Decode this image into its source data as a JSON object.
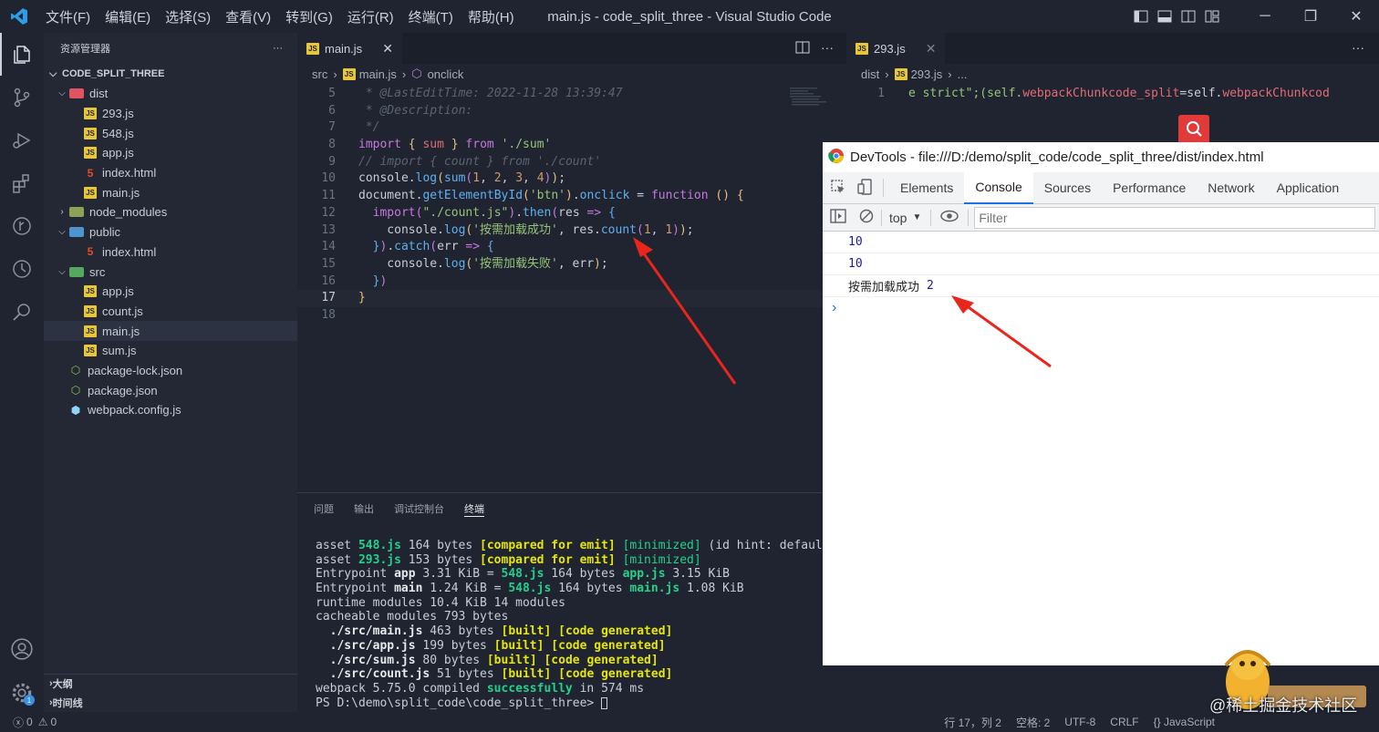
{
  "titlebar": {
    "menus": [
      "文件(F)",
      "编辑(E)",
      "选择(S)",
      "查看(V)",
      "转到(G)",
      "运行(R)",
      "终端(T)",
      "帮助(H)"
    ],
    "title": "main.js - code_split_three - Visual Studio Code"
  },
  "explorer": {
    "header": "资源管理器",
    "more": "···",
    "project": "CODE_SPLIT_THREE",
    "tree": [
      {
        "label": "dist",
        "type": "folder"
      },
      {
        "label": "293.js",
        "type": "js"
      },
      {
        "label": "548.js",
        "type": "js"
      },
      {
        "label": "app.js",
        "type": "js"
      },
      {
        "label": "index.html",
        "type": "html"
      },
      {
        "label": "main.js",
        "type": "js"
      },
      {
        "label": "node_modules",
        "type": "folder"
      },
      {
        "label": "public",
        "type": "folder"
      },
      {
        "label": "index.html",
        "type": "html"
      },
      {
        "label": "src",
        "type": "folder"
      },
      {
        "label": "app.js",
        "type": "js"
      },
      {
        "label": "count.js",
        "type": "js"
      },
      {
        "label": "main.js",
        "type": "js"
      },
      {
        "label": "sum.js",
        "type": "js"
      },
      {
        "label": "package-lock.json",
        "type": "json"
      },
      {
        "label": "package.json",
        "type": "json"
      },
      {
        "label": "webpack.config.js",
        "type": "config"
      }
    ],
    "outline": "大纲",
    "timeline": "时间线"
  },
  "editor": {
    "tab": "main.js",
    "breadcrumb": [
      "src",
      "main.js",
      "onclick"
    ],
    "line_numbers": [
      "5",
      "6",
      "7",
      "8",
      "9",
      "10",
      "11",
      "12",
      "13",
      "14",
      "15",
      "16",
      "17",
      "18"
    ]
  },
  "editor2": {
    "tab": "293.js",
    "breadcrumb": [
      "dist",
      "293.js",
      "..."
    ],
    "line": "1",
    "code_a": "e strict\";(self.",
    "code_b": "webpackChunkcode_split",
    "code_c": "=self.",
    "code_d": "webpackChunkcod"
  },
  "panel": {
    "tabs": [
      "问题",
      "输出",
      "调试控制台",
      "终端"
    ],
    "active_tab": "终端"
  },
  "devtools": {
    "title": "DevTools - file:///D:/demo/split_code/code_split_three/dist/index.html",
    "tabs": [
      "Elements",
      "Console",
      "Sources",
      "Performance",
      "Network",
      "Application"
    ],
    "active_tab": "Console",
    "context": "top",
    "filter_placeholder": "Filter",
    "logs": [
      "10",
      "10"
    ],
    "log3_text": "按需加载成功",
    "log3_num": "2",
    "prompt": "›"
  },
  "statusbar": {
    "errors": "0",
    "warnings": "0",
    "position": "行 17，列 2",
    "spaces": "空格: 2",
    "encoding": "UTF-8",
    "eol": "CRLF",
    "language": "{} JavaScript"
  },
  "watermark": "@稀土掘金技术社区",
  "colors": {
    "accent": "#1a73e8",
    "arrow": "#e8261c",
    "term_green": "#23d18b",
    "term_yellow": "#e5e510"
  }
}
